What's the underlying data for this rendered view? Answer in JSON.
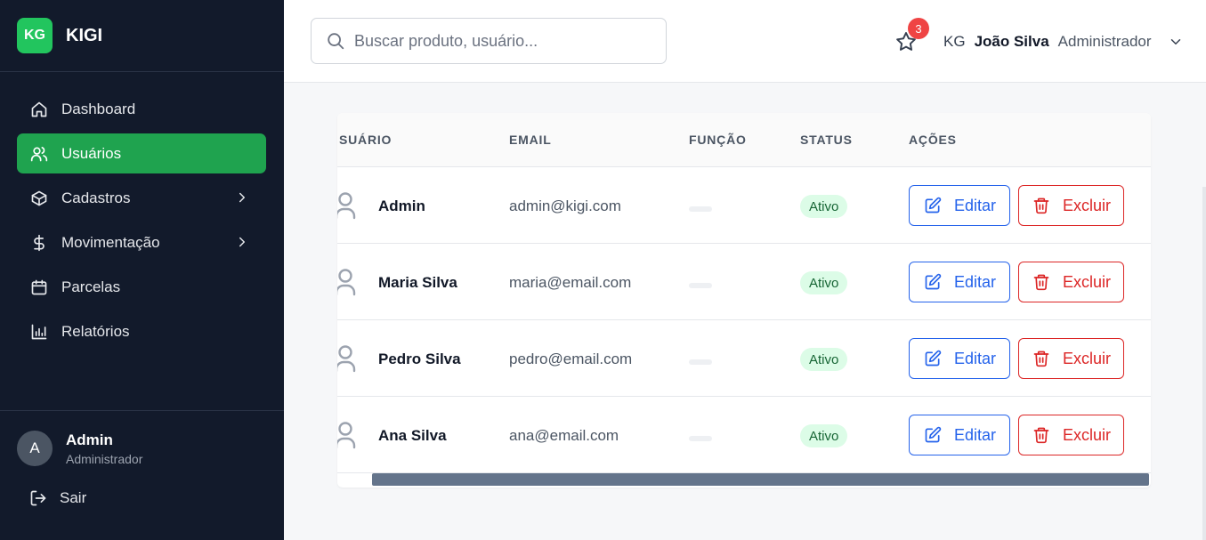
{
  "brand": {
    "logo": "KG",
    "name": "KIGI"
  },
  "sidebar": {
    "items": [
      {
        "label": "Dashboard",
        "icon": "home-icon",
        "active": false,
        "has_submenu": false
      },
      {
        "label": "Usuários",
        "icon": "users-icon",
        "active": true,
        "has_submenu": false
      },
      {
        "label": "Cadastros",
        "icon": "box-icon",
        "active": false,
        "has_submenu": true
      },
      {
        "label": "Movimentação",
        "icon": "dollar-icon",
        "active": false,
        "has_submenu": true
      },
      {
        "label": "Parcelas",
        "icon": "calendar-icon",
        "active": false,
        "has_submenu": false
      },
      {
        "label": "Relatórios",
        "icon": "bar-chart-icon",
        "active": false,
        "has_submenu": false
      }
    ],
    "user": {
      "avatar": "A",
      "name": "Admin",
      "role": "Administrador"
    },
    "logout_label": "Sair"
  },
  "header": {
    "search_placeholder": "Buscar produto, usuário...",
    "notification_count": "3",
    "profile": {
      "initials": "KG",
      "name": "João Silva",
      "role": "Administrador"
    }
  },
  "table": {
    "columns": [
      "SUÁRIO",
      "EMAIL",
      "FUNÇÃO",
      "STATUS",
      "AÇÕES"
    ],
    "edit_label": "Editar",
    "delete_label": "Excluir",
    "rows": [
      {
        "name": "Admin",
        "email": "admin@kigi.com",
        "status": "Ativo"
      },
      {
        "name": "Maria Silva",
        "email": "maria@email.com",
        "status": "Ativo"
      },
      {
        "name": "Pedro Silva",
        "email": "pedro@email.com",
        "status": "Ativo"
      },
      {
        "name": "Ana Silva",
        "email": "ana@email.com",
        "status": "Ativo"
      }
    ]
  },
  "colors": {
    "sidebar_bg": "#121a2b",
    "accent_green": "#1fa34f",
    "edit_blue": "#2563eb",
    "delete_red": "#dc2626",
    "status_bg": "#dcfce7",
    "badge_red": "#ef4444"
  }
}
